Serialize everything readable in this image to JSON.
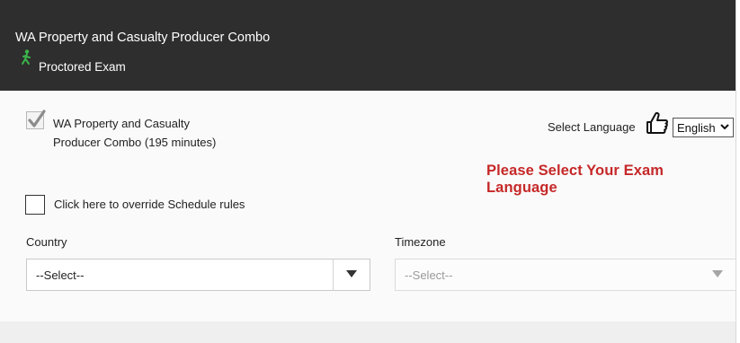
{
  "header": {
    "title": "WA Property and Casualty Producer Combo",
    "subtitle": "Proctored Exam",
    "icon": "proctor-person-icon"
  },
  "exam": {
    "checked": true,
    "label_line1": "WA Property and Casualty",
    "label_line2": "Producer Combo (195 minutes)"
  },
  "language": {
    "label": "Select Language",
    "icon": "pointing-hand-icon",
    "selected": "English",
    "prompt": "Please Select Your Exam Language"
  },
  "override": {
    "checked": false,
    "label": "Click here to override Schedule rules"
  },
  "country": {
    "label": "Country",
    "selected": "--Select--"
  },
  "timezone": {
    "label": "Timezone",
    "selected": "--Select--",
    "disabled": true
  },
  "colors": {
    "header_bg": "#2e2e2e",
    "prompt_red": "#c62828",
    "proctor_icon_green": "#3bb54a",
    "check_gray": "#8c8c8c"
  }
}
